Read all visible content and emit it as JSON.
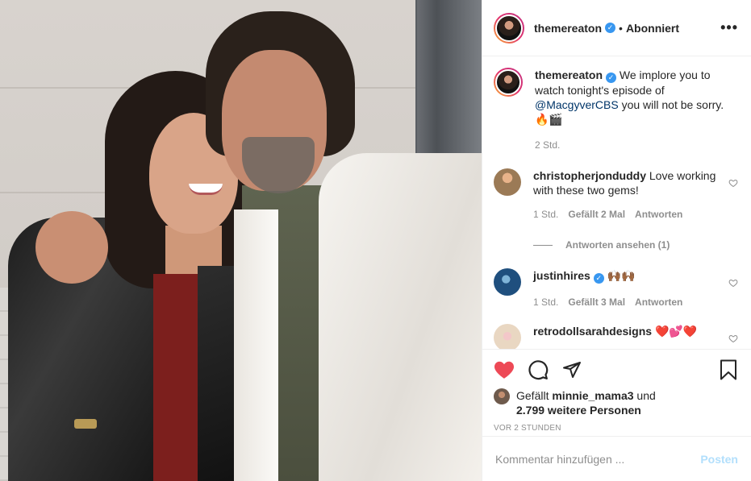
{
  "header": {
    "username": "themereaton",
    "dot": "•",
    "follow_label": "Abonniert",
    "more_icon": "more-horizontal-icon"
  },
  "caption": {
    "username": "themereaton",
    "text_before": "We implore you to watch tonight's episode of",
    "mention": "@MacgyverCBS",
    "text_after": "you will not be sorry.",
    "emoji": "🔥🎬",
    "time": "2 Std."
  },
  "comments": [
    {
      "username": "christopherjonduddy",
      "text": "Love working with these two gems!",
      "time": "1 Std.",
      "likes": "Gefällt 2 Mal",
      "reply": "Antworten",
      "view_replies": "Antworten ansehen (1)",
      "avatar_color": "#9b7a56"
    },
    {
      "username": "justinhires",
      "text": "🙌🏾🙌🏾",
      "time": "1 Std.",
      "likes": "Gefällt 3 Mal",
      "reply": "Antworten",
      "avatar_color": "#1f4f7e"
    },
    {
      "username": "retrodollsarahdesigns",
      "text": "❤️💕❤️",
      "avatar_color": "#e9d7c2"
    }
  ],
  "actions": {
    "liked_by_prefix": "Gefällt",
    "liked_by_user": "minnie_mama3",
    "liked_by_joiner": "und",
    "liked_by_others": "2.799 weitere Personen",
    "timestamp": "VOR 2 STUNDEN"
  },
  "add_comment": {
    "placeholder": "Kommentar hinzufügen ...",
    "post_label": "Posten"
  },
  "colors": {
    "like_red": "#ed4956",
    "verified_blue": "#3897f0",
    "post_disabled": "#b2dffc"
  }
}
